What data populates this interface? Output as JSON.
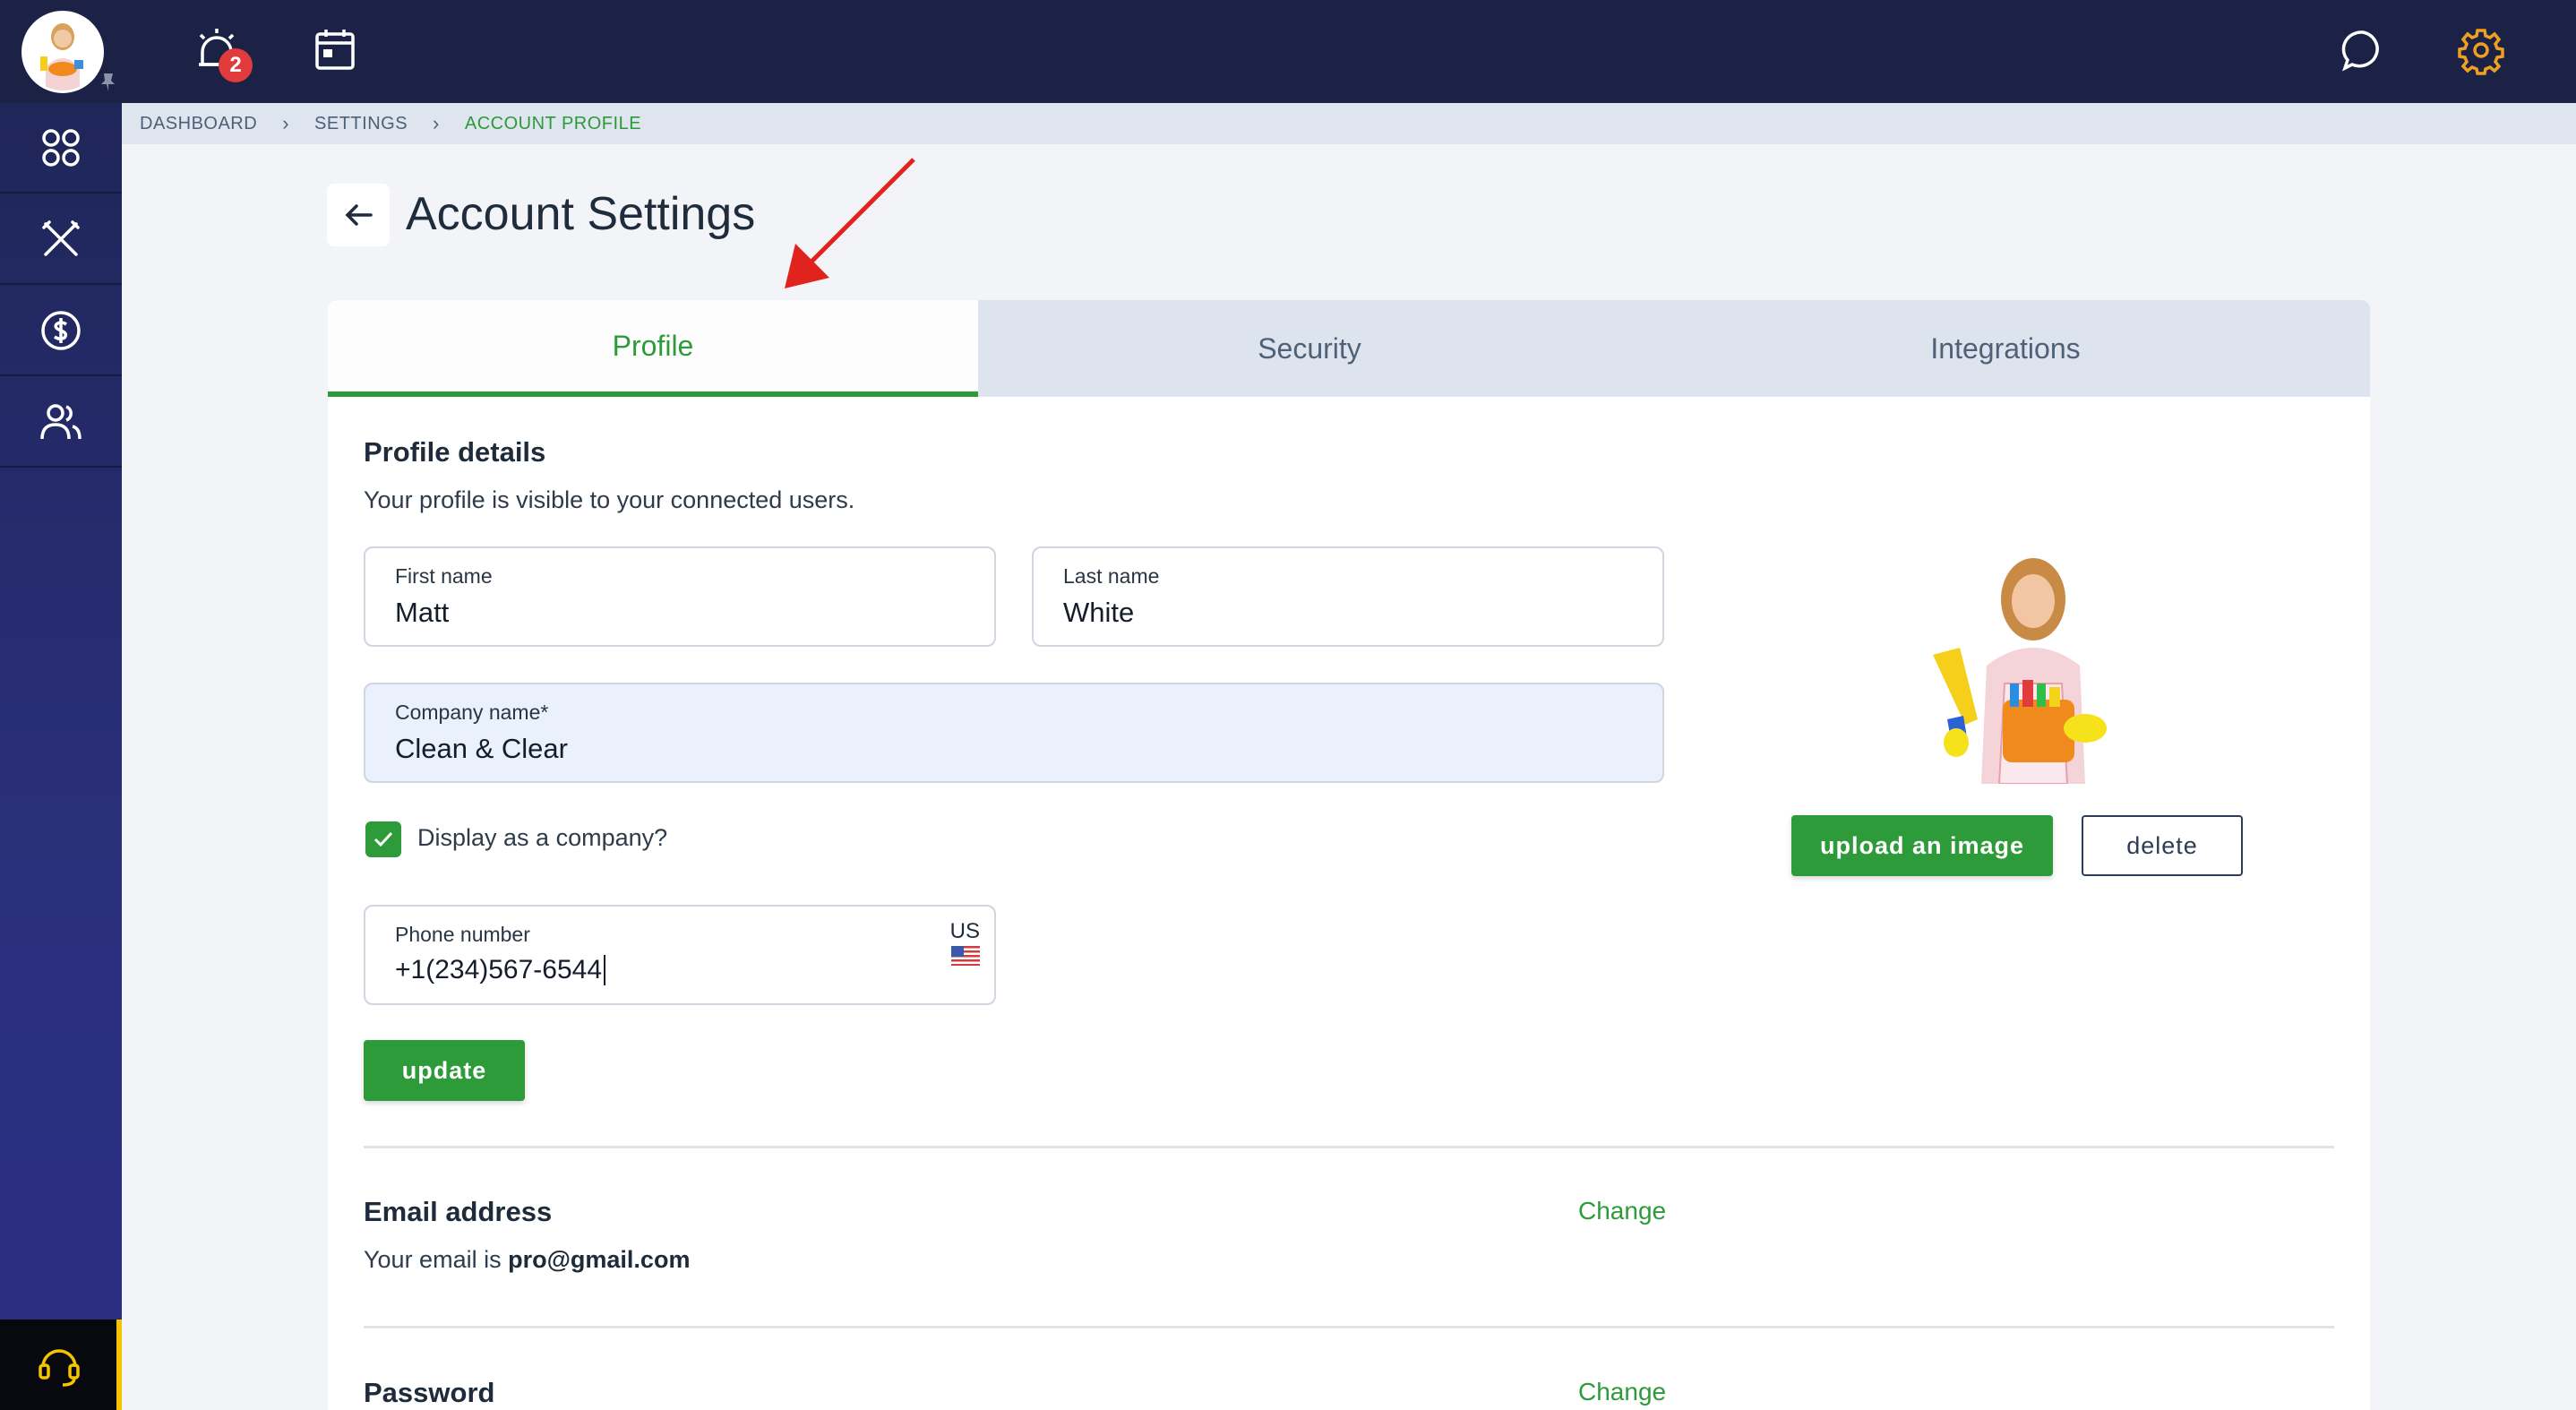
{
  "topbar": {
    "notification_count": "2",
    "icons": [
      "alarm-icon",
      "calendar-icon",
      "chat-icon",
      "gear-icon"
    ]
  },
  "sidebar": {
    "items": [
      "apps-icon",
      "tools-icon",
      "dollar-icon",
      "users-icon"
    ],
    "support_icon": "headset-icon"
  },
  "breadcrumb": {
    "items": [
      "DASHBOARD",
      "SETTINGS",
      "ACCOUNT PROFILE"
    ]
  },
  "page": {
    "title": "Account Settings"
  },
  "tabs": [
    {
      "label": "Profile",
      "active": true
    },
    {
      "label": "Security",
      "active": false
    },
    {
      "label": "Integrations",
      "active": false
    }
  ],
  "profile": {
    "title": "Profile details",
    "subtitle": "Your profile is visible to your connected users.",
    "first_name_label": "First name",
    "first_name": "Matt",
    "last_name_label": "Last name",
    "last_name": "White",
    "company_label": "Company name*",
    "company": "Clean & Clear",
    "display_company_label": "Display as a company?",
    "display_company_checked": true,
    "phone_label": "Phone number",
    "phone": "+1(234)567-6544",
    "phone_country": "US",
    "update_label": "update",
    "upload_label": "upload an image",
    "delete_label": "delete"
  },
  "email": {
    "title": "Email address",
    "text_prefix": "Your email is",
    "address": "pro@gmail.com",
    "change_label": "Change"
  },
  "password": {
    "title": "Password",
    "change_label": "Change"
  },
  "colors": {
    "accent": "#2e9b3a",
    "topbar": "#1b2246",
    "settings_icon": "#f0a020"
  }
}
